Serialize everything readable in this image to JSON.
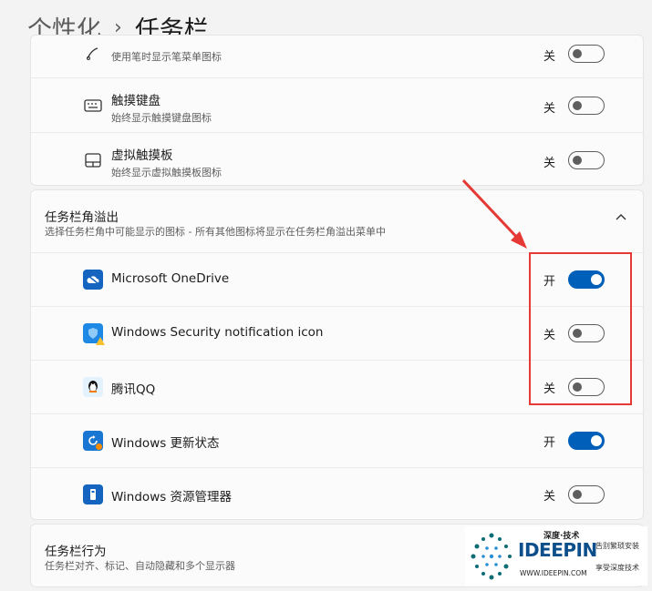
{
  "header": {
    "parent": "个性化",
    "separator": "›",
    "title": "任务栏"
  },
  "top_items": [
    {
      "title": "",
      "subtitle": "使用笔时显示笔菜单图标",
      "state": "关",
      "on": false,
      "icon": "pen-icon"
    },
    {
      "title": "触摸键盘",
      "subtitle": "始终显示触摸键盘图标",
      "state": "关",
      "on": false,
      "icon": "keyboard-icon"
    },
    {
      "title": "虚拟触摸板",
      "subtitle": "始终显示虚拟触摸板图标",
      "state": "关",
      "on": false,
      "icon": "touchpad-icon"
    }
  ],
  "overflow": {
    "title": "任务栏角溢出",
    "subtitle": "选择任务栏角中可能显示的图标 - 所有其他图标将显示在任务栏角溢出菜单中",
    "items": [
      {
        "title": "Microsoft OneDrive",
        "state": "开",
        "on": true,
        "icon": "onedrive-icon"
      },
      {
        "title": "Windows Security notification icon",
        "state": "关",
        "on": false,
        "icon": "security-icon"
      },
      {
        "title": "腾讯QQ",
        "state": "关",
        "on": false,
        "icon": "qq-icon"
      },
      {
        "title": "Windows 更新状态",
        "state": "开",
        "on": true,
        "icon": "update-icon"
      },
      {
        "title": "Windows 资源管理器",
        "state": "关",
        "on": false,
        "icon": "explorer-icon"
      }
    ]
  },
  "behavior": {
    "title": "任务栏行为",
    "subtitle": "任务栏对齐、标记、自动隐藏和多个显示器"
  },
  "watermark": {
    "brand": "IDEEPIN",
    "top": "深度·技术",
    "url": "WWW.IDEEPIN.COM",
    "right1": "告别繁琐安装",
    "right2": "享受深度技术"
  },
  "colors": {
    "accent": "#005fb8",
    "annotation": "#e53935"
  }
}
